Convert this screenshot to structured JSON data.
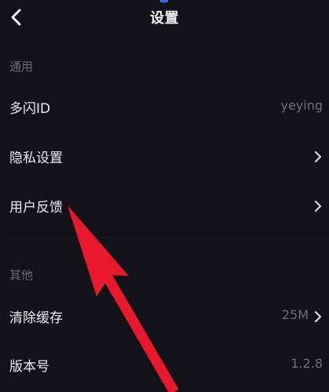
{
  "header": {
    "title": "设置",
    "back_icon": "chevron-left-icon"
  },
  "sections": {
    "general": {
      "label": "通用",
      "items": [
        {
          "label": "多闪ID",
          "value": "yeying"
        },
        {
          "label": "隐私设置",
          "value": ""
        },
        {
          "label": "用户反馈",
          "value": ""
        }
      ]
    },
    "other": {
      "label": "其他",
      "items": [
        {
          "label": "清除缓存",
          "value": "25M"
        },
        {
          "label": "版本号",
          "value": "1.2.8"
        }
      ]
    }
  },
  "colors": {
    "background": "#121218",
    "accent_top": "#2d6cff",
    "annotation_arrow": "#e8192c"
  },
  "annotation": {
    "type": "arrow",
    "icon": "red-arrow-annotation",
    "points_to": "用户反馈"
  }
}
